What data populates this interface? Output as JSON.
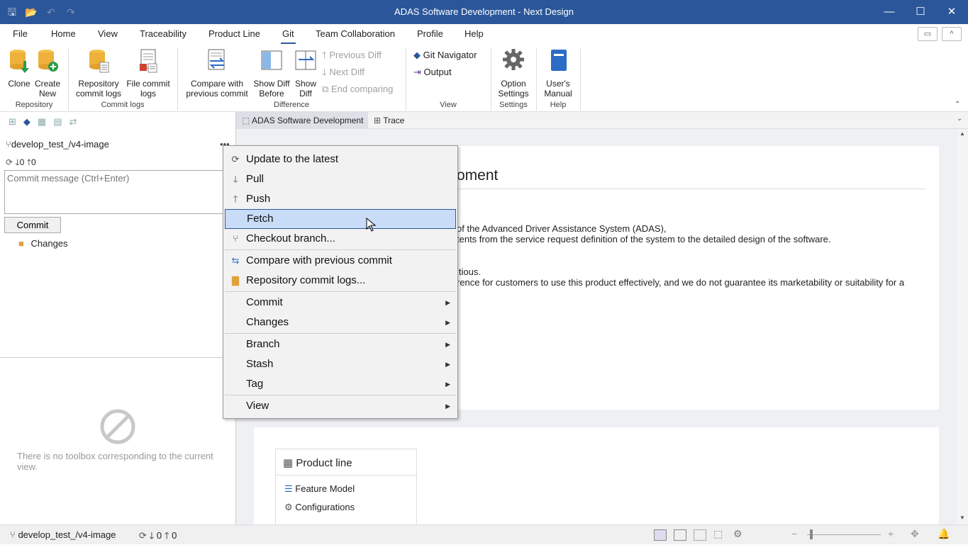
{
  "window": {
    "title": "ADAS Software Development - Next Design",
    "minimize": "—",
    "maximize": "☐",
    "close": "✕"
  },
  "quick_access": {
    "save": "🖫",
    "open": "📂",
    "undo": "↶",
    "redo": "↷"
  },
  "menus": [
    "File",
    "Home",
    "View",
    "Traceability",
    "Product Line",
    "Git",
    "Team Collaboration",
    "Profile",
    "Help"
  ],
  "ribbon": {
    "clone": "Clone",
    "create_new": [
      "Create",
      "New"
    ],
    "repo_commit_logs": [
      "Repository",
      "commit logs"
    ],
    "file_commit_logs": [
      "File commit",
      "logs"
    ],
    "compare_prev": [
      "Compare with",
      "previous commit"
    ],
    "show_diff_before": [
      "Show Diff",
      "Before"
    ],
    "show_diff": [
      "Show",
      "Diff"
    ],
    "previous_diff": "Previous Diff",
    "next_diff": "Next Diff",
    "end_comparing": "End comparing",
    "git_navigator": "Git Navigator",
    "output": "Output",
    "option_settings": [
      "Option",
      "Settings"
    ],
    "users_manual": [
      "User's",
      "Manual"
    ],
    "groups": {
      "repository": "Repository",
      "commit_logs": "Commit logs",
      "difference": "Difference",
      "view": "View",
      "settings": "Settings",
      "help": "Help"
    }
  },
  "left": {
    "branch": "develop_test_/v4-image",
    "incoming": "0",
    "outgoing": "0",
    "commit_placeholder": "Commit message (Ctrl+Enter)",
    "commit_button": "Commit",
    "changes": "Changes",
    "toolbox_empty": "There is no toolbox corresponding to the current view."
  },
  "tabs": [
    {
      "label": "ADAS Software Development"
    },
    {
      "label": "Trace"
    }
  ],
  "document": {
    "heading_fragment": "oment",
    "lines": [
      "of the Advanced Driver Assistance System (ADAS),",
      "tents from the service request definition of the system to the detailed design of the software.",
      "itious.",
      "rence for customers to use this product effectively, and we do not guarantee its marketability or suitability for a"
    ],
    "product_line": {
      "title": "Product line",
      "items": [
        "Feature Model",
        "Configurations"
      ]
    }
  },
  "context_menu": {
    "items": [
      {
        "label": "Update to the latest"
      },
      {
        "label": "Pull"
      },
      {
        "label": "Push"
      },
      {
        "label": "Fetch"
      },
      {
        "label": "Checkout branch..."
      },
      {
        "label": "Compare with previous commit"
      },
      {
        "label": "Repository commit logs..."
      },
      {
        "label": "Commit"
      },
      {
        "label": "Changes"
      },
      {
        "label": "Branch"
      },
      {
        "label": "Stash"
      },
      {
        "label": "Tag"
      },
      {
        "label": "View"
      }
    ]
  },
  "status": {
    "branch": "develop_test_/v4-image",
    "incoming": "0",
    "outgoing": "0"
  },
  "colors": {
    "accent": "#2b579a",
    "highlight": "#c9dcf7"
  }
}
